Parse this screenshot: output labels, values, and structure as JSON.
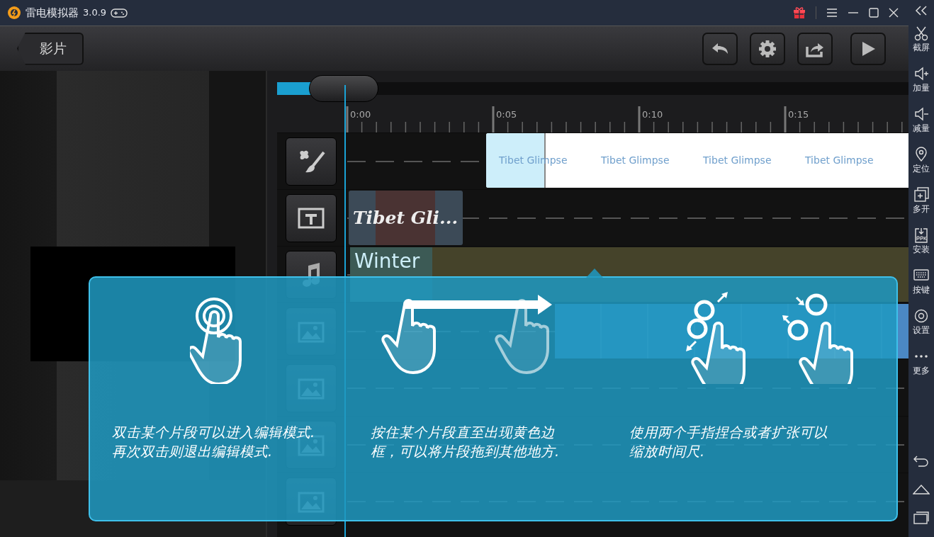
{
  "title_bar": {
    "app_name": "雷电模拟器",
    "version": "3.0.9"
  },
  "toolbar": {
    "back_label": "影片"
  },
  "timeline": {
    "zoom": {
      "level": 0.055
    },
    "ruler_labels": [
      "0:00",
      "0:05",
      "0:10",
      "0:15"
    ],
    "tracks": [
      {
        "kind": "effect",
        "clips": [
          "Tibet Glimpse",
          "Tibet Glimpse",
          "Tibet Glimpse",
          "Tibet Glimpse"
        ]
      },
      {
        "kind": "title",
        "clips": [
          "Tibet Gli..."
        ]
      },
      {
        "kind": "music",
        "clips": [
          "Winter"
        ]
      },
      {
        "kind": "photo"
      },
      {
        "kind": "photo"
      },
      {
        "kind": "photo"
      },
      {
        "kind": "photo"
      }
    ]
  },
  "hints": [
    {
      "kind": "double-tap",
      "lines": [
        "双击某个片段可以进入编辑模式.",
        "再次双击则退出编辑模式."
      ]
    },
    {
      "kind": "drag",
      "lines": [
        "按住某个片段直至出现黄色边",
        "框，可以将片段拖到其他地方."
      ]
    },
    {
      "kind": "pinch",
      "lines": [
        "使用两个手指捏合或者扩张可以",
        "缩放时间尺."
      ]
    }
  ],
  "sidebar": {
    "items": [
      {
        "label": "截屏"
      },
      {
        "label": "加量"
      },
      {
        "label": "减量"
      },
      {
        "label": "定位"
      },
      {
        "label": "多开"
      },
      {
        "label": "安装"
      },
      {
        "label": "按键"
      },
      {
        "label": "设置"
      },
      {
        "label": "更多"
      }
    ]
  }
}
